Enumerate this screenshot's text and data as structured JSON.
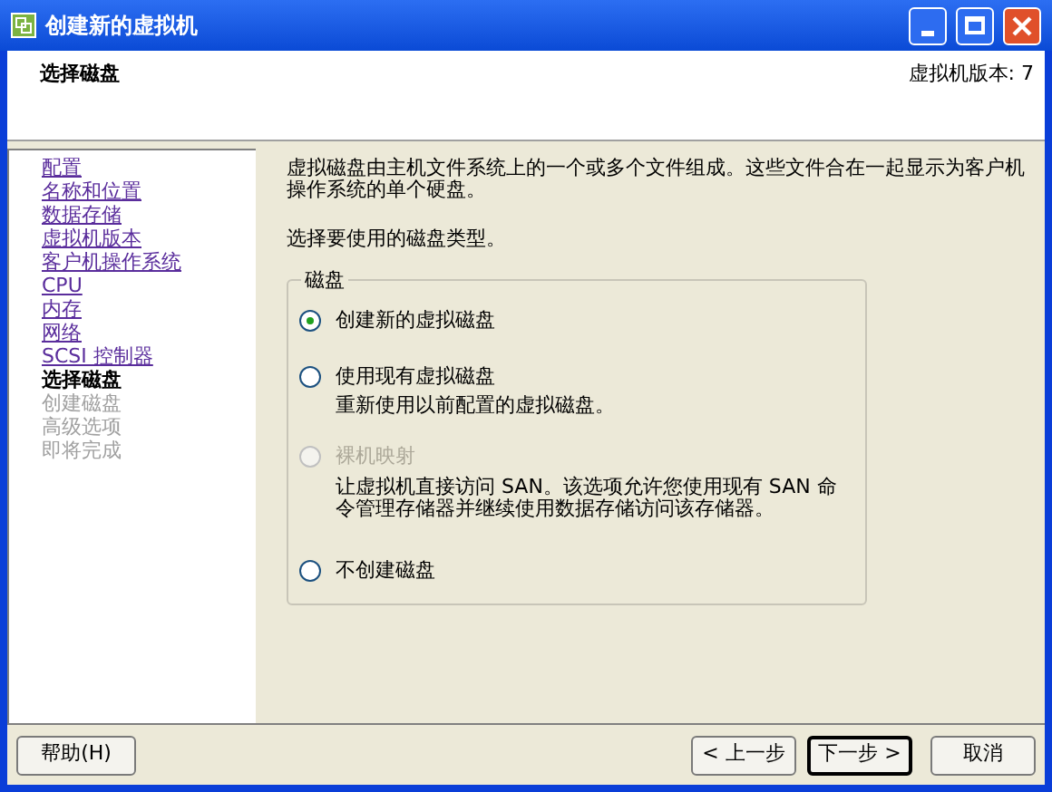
{
  "window": {
    "title": "创建新的虚拟机"
  },
  "header": {
    "title": "选择磁盘",
    "version": "虚拟机版本: 7"
  },
  "sidebar": {
    "items": [
      {
        "label": "配置",
        "kind": "link"
      },
      {
        "label": "名称和位置",
        "kind": "link"
      },
      {
        "label": "数据存储",
        "kind": "link"
      },
      {
        "label": "虚拟机版本",
        "kind": "link"
      },
      {
        "label": "客户机操作系统",
        "kind": "link"
      },
      {
        "label": "CPU",
        "kind": "link"
      },
      {
        "label": "内存",
        "kind": "link"
      },
      {
        "label": "网络",
        "kind": "link"
      },
      {
        "label": "SCSI 控制器",
        "kind": "link"
      },
      {
        "label": "选择磁盘",
        "kind": "current"
      },
      {
        "label": "创建磁盘",
        "kind": "pending"
      },
      {
        "label": "高级选项",
        "kind": "pending"
      },
      {
        "label": "即将完成",
        "kind": "pending"
      }
    ]
  },
  "content": {
    "intro": "虚拟磁盘由主机文件系统上的一个或多个文件组成。这些文件合在一起显示为客户机操作系统的单个硬盘。",
    "prompt": "选择要使用的磁盘类型。",
    "group": {
      "title": "磁盘",
      "options": [
        {
          "label": "创建新的虚拟磁盘",
          "selected": true,
          "disabled": false
        },
        {
          "label": "使用现有虚拟磁盘",
          "selected": false,
          "disabled": false,
          "description": "重新使用以前配置的虚拟磁盘。"
        },
        {
          "label": "裸机映射",
          "selected": false,
          "disabled": true,
          "description": "让虚拟机直接访问 SAN。该选项允许您使用现有 SAN 命令管理存储器并继续使用数据存储访问该存储器。"
        },
        {
          "label": "不创建磁盘",
          "selected": false,
          "disabled": false
        }
      ]
    }
  },
  "buttons": {
    "help": "帮助(H)",
    "back": "< 上一步",
    "next": "下一步 >",
    "cancel": "取消"
  }
}
